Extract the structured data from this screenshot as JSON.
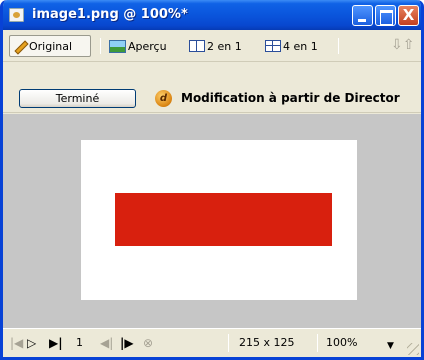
{
  "window": {
    "title": "image1.png @ 100%*",
    "title_bar_color": "#0a55dc"
  },
  "title_bar": {
    "icons": [
      "minimize-icon",
      "maximize-icon",
      "close-icon"
    ],
    "close_symbol": "X"
  },
  "view_tabs": [
    {
      "label": "Original",
      "icon": "pencil-icon",
      "selected": true
    },
    {
      "label": "Aperçu",
      "icon": "preview-icon",
      "selected": false
    },
    {
      "label": "2 en 1",
      "icon": "split-2-icon",
      "selected": false
    },
    {
      "label": "4 en 1",
      "icon": "split-4-icon",
      "selected": false
    }
  ],
  "toolbar2": {
    "done_label": "Terminé",
    "director_icon_letter": "d",
    "director_label": "Modification à partir de Director"
  },
  "canvas": {
    "background_color": "#c6c6c6",
    "page_color": "#ffffff",
    "shape_color": "#d8200e"
  },
  "status_bar": {
    "frame": "1",
    "image_size": "215 x 125",
    "zoom": "100%"
  }
}
